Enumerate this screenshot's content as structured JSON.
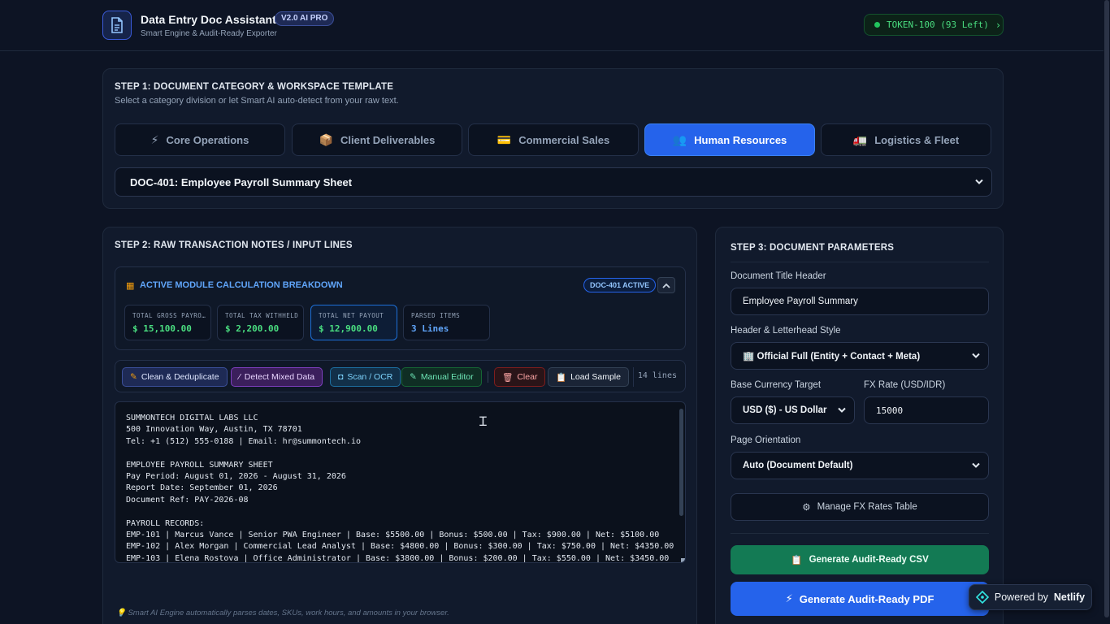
{
  "header": {
    "title": "Data Entry Doc Assistant",
    "version_badge": "V2.0 AI PRO",
    "subtitle": "Smart Engine & Audit-Ready Exporter",
    "token_label": "TOKEN-100 (93 Left)"
  },
  "step1": {
    "title": "STEP 1: DOCUMENT CATEGORY & WORKSPACE TEMPLATE",
    "subtitle": "Select a category division or let Smart AI auto-detect from your raw text.",
    "tabs": [
      {
        "label": "Core Operations",
        "icon": "⚡"
      },
      {
        "label": "Client Deliverables",
        "icon": "📦"
      },
      {
        "label": "Commercial Sales",
        "icon": "💳"
      },
      {
        "label": "Human Resources",
        "icon": "👥",
        "active": true
      },
      {
        "label": "Logistics & Fleet",
        "icon": "🚛"
      }
    ],
    "selected_doc": "DOC-401: Employee Payroll Summary Sheet"
  },
  "step2": {
    "title": "STEP 2: RAW TRANSACTION NOTES / INPUT LINES",
    "module_title": "ACTIVE MODULE CALCULATION BREAKDOWN",
    "module_badge": "DOC-401 ACTIVE",
    "stats": [
      {
        "label": "TOTAL GROSS PAYROLL",
        "value": "$ 15,100.00"
      },
      {
        "label": "TOTAL TAX WITHHELD",
        "value": "$ 2,200.00"
      },
      {
        "label": "TOTAL NET PAYOUT",
        "value": "$ 12,900.00"
      },
      {
        "label": "PARSED ITEMS",
        "value": "3 Lines"
      }
    ],
    "toolbar": {
      "clean": "Clean & Deduplicate",
      "detect": "Detect Mixed Data",
      "scan": "Scan / OCR",
      "manual": "Manual Editor",
      "clear": "Clear",
      "load": "Load Sample",
      "line_count": "14 lines"
    },
    "raw_text": "SUMMONTECH DIGITAL LABS LLC\n500 Innovation Way, Austin, TX 78701\nTel: +1 (512) 555-0188 | Email: hr@summontech.io\n\nEMPLOYEE PAYROLL SUMMARY SHEET\nPay Period: August 01, 2026 - August 31, 2026\nReport Date: September 01, 2026\nDocument Ref: PAY-2026-08\n\nPAYROLL RECORDS:\nEMP-101 | Marcus Vance | Senior PWA Engineer | Base: $5500.00 | Bonus: $500.00 | Tax: $900.00 | Net: $5100.00\nEMP-102 | Alex Morgan | Commercial Lead Analyst | Base: $4800.00 | Bonus: $300.00 | Tax: $750.00 | Net: $4350.00\nEMP-103 | Elena Rostova | Office Administrator | Base: $3800.00 | Bonus: $200.00 | Tax: $550.00 | Net: $3450.00",
    "hint": "💡 Smart AI Engine automatically parses dates, SKUs, work hours, and amounts in your browser."
  },
  "step3": {
    "title": "STEP 3: DOCUMENT PARAMETERS",
    "doc_title_label": "Document Title Header",
    "doc_title_value": "Employee Payroll Summary",
    "letterhead_label": "Header & Letterhead Style",
    "letterhead_value": "🏢 Official Full (Entity + Contact + Meta)",
    "currency_label": "Base Currency Target",
    "currency_value": "USD ($) - US Dollar",
    "fx_label": "FX Rate (USD/IDR)",
    "fx_value": "15000",
    "orientation_label": "Page Orientation",
    "orientation_value": "Auto (Document Default)",
    "manage_fx": "Manage FX Rates Table",
    "csv_button": "Generate Audit-Ready CSV",
    "pdf_button": "Generate Audit-Ready PDF"
  },
  "netlify": {
    "prefix": "Powered by",
    "brand": "Netlify"
  }
}
